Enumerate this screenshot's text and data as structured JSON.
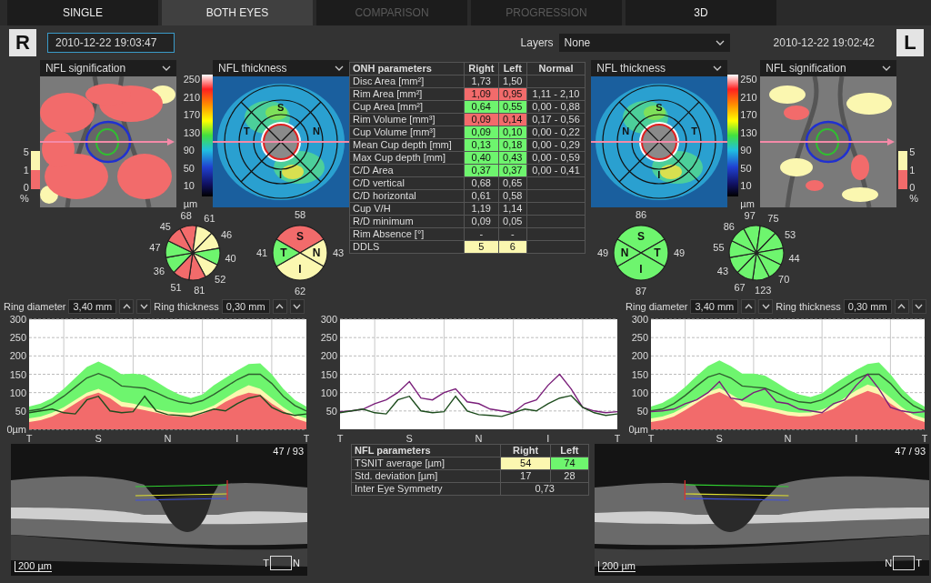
{
  "tabs": [
    {
      "label": "SINGLE",
      "selected": false,
      "disabled": false
    },
    {
      "label": "BOTH EYES",
      "selected": true,
      "disabled": false
    },
    {
      "label": "COMPARISON",
      "selected": false,
      "disabled": true
    },
    {
      "label": "PROGRESSION",
      "selected": false,
      "disabled": true
    },
    {
      "label": "3D",
      "selected": false,
      "disabled": false
    }
  ],
  "header": {
    "right_eye_badge": "R",
    "right_date": "2010-12-22 19:03:47",
    "layers_label": "Layers",
    "layers_value": "None",
    "left_date": "2010-12-22 19:02:42",
    "left_eye_badge": "L"
  },
  "right_eye": {
    "signification": {
      "title": "NFL signification",
      "legend": [
        "5",
        "1",
        "0",
        "%"
      ]
    },
    "thickness": {
      "title": "NFL thickness",
      "scale": [
        "250",
        "210",
        "170",
        "130",
        "90",
        "50",
        "10",
        "µm"
      ],
      "labels": [
        "S",
        "N",
        "I",
        "T"
      ]
    },
    "clock_sectors": [
      {
        "value": "68",
        "color": "#f26b6b"
      },
      {
        "value": "61",
        "color": "#fbf7b0"
      },
      {
        "value": "46",
        "color": "#fbf7b0"
      },
      {
        "value": "40",
        "color": "#6ef56e"
      },
      {
        "value": "52",
        "color": "#fbf7b0"
      },
      {
        "value": "81",
        "color": "#f26b6b"
      },
      {
        "value": "51",
        "color": "#f26b6b"
      },
      {
        "value": "36",
        "color": "#6ef56e"
      },
      {
        "value": "47",
        "color": "#6ef56e"
      },
      {
        "value": "45",
        "color": "#f26b6b"
      }
    ],
    "quadrants": [
      {
        "label": "S",
        "value": "58",
        "color": "#f26b6b"
      },
      {
        "label": "N",
        "value": "43",
        "color": "#fbf7b0"
      },
      {
        "label": "I",
        "value": "62",
        "color": "#fbf7b0"
      },
      {
        "label": "T",
        "value": "41",
        "color": "#6ef56e"
      }
    ],
    "ring": {
      "diameter_label": "Ring diameter",
      "diameter": "3,40 mm",
      "thickness_label": "Ring thickness",
      "thickness": "0,30 mm"
    },
    "tsnit": {
      "chart_data": {
        "type": "area",
        "grid": true,
        "categories": [
          "T",
          null,
          null,
          null,
          null,
          null,
          "S",
          null,
          null,
          null,
          null,
          null,
          "N",
          null,
          null,
          null,
          null,
          null,
          "I",
          null,
          null,
          null,
          null,
          null,
          "T"
        ],
        "ylim": [
          0,
          300
        ],
        "yticks": [
          {
            "value": 0,
            "label": "0µm"
          },
          50,
          100,
          150,
          200,
          250,
          300
        ],
        "series": [
          {
            "color": "#6ef56e",
            "values": [
              62,
              70,
              85,
              110,
              140,
              170,
              185,
              170,
              150,
              152,
              148,
              130,
              110,
              95,
              85,
              95,
              120,
              140,
              160,
              178,
              180,
              150,
              110,
              80,
              62
            ]
          },
          {
            "color": "#fbf7b0",
            "values": [
              30,
              35,
              45,
              60,
              80,
              100,
              110,
              95,
              75,
              70,
              62,
              55,
              48,
              45,
              45,
              52,
              65,
              85,
              105,
              120,
              110,
              85,
              60,
              40,
              30
            ]
          },
          {
            "color": "#f26b6b",
            "values": [
              20,
              25,
              35,
              50,
              70,
              90,
              100,
              85,
              62,
              58,
              52,
              45,
              38,
              35,
              35,
              42,
              55,
              75,
              90,
              100,
              95,
              70,
              50,
              30,
              20
            ]
          },
          {
            "type": "line",
            "color": "#2f5f2f",
            "values": [
              50,
              55,
              70,
              90,
              115,
              140,
              152,
              140,
              118,
              115,
              112,
              100,
              85,
              75,
              70,
              78,
              95,
              115,
              135,
              150,
              150,
              125,
              90,
              65,
              50
            ]
          },
          {
            "type": "line",
            "color": "#1e4d1e",
            "values": [
              45,
              50,
              55,
              45,
              42,
              80,
              90,
              50,
              45,
              48,
              90,
              50,
              40,
              38,
              35,
              45,
              55,
              50,
              70,
              85,
              92,
              60,
              45,
              38,
              42
            ]
          }
        ]
      }
    },
    "bscan": {
      "counter": "47 / 93",
      "scale": "200 µm",
      "orientation": [
        "T",
        "N"
      ]
    }
  },
  "onh_table": {
    "columns": [
      "ONH parameters",
      "Right",
      "Left",
      "Normal"
    ],
    "rows": [
      {
        "label": "Disc Area [mm²]",
        "right": {
          "text": "1,73"
        },
        "left": {
          "text": "1,50"
        }
      },
      {
        "label": "Rim Area [mm²]",
        "right": {
          "text": "1,09",
          "color": "#f26b6b"
        },
        "left": {
          "text": "0,95",
          "color": "#f26b6b"
        },
        "normal": "1,11 - 2,10"
      },
      {
        "label": "Cup Area [mm²]",
        "right": {
          "text": "0,64",
          "color": "#6ef56e"
        },
        "left": {
          "text": "0,55",
          "color": "#6ef56e"
        },
        "normal": "0,00 - 0,88"
      },
      {
        "label": "Rim Volume [mm³]",
        "right": {
          "text": "0,09",
          "color": "#f26b6b"
        },
        "left": {
          "text": "0,14",
          "color": "#f26b6b"
        },
        "normal": "0,17 - 0,56"
      },
      {
        "label": "Cup Volume [mm³]",
        "right": {
          "text": "0,09",
          "color": "#6ef56e"
        },
        "left": {
          "text": "0,10",
          "color": "#6ef56e"
        },
        "normal": "0,00 - 0,22"
      },
      {
        "label": "Mean Cup depth [mm]",
        "right": {
          "text": "0,13",
          "color": "#6ef56e"
        },
        "left": {
          "text": "0,18",
          "color": "#6ef56e"
        },
        "normal": "0,00 - 0,29"
      },
      {
        "label": "Max Cup depth [mm]",
        "right": {
          "text": "0,40",
          "color": "#6ef56e"
        },
        "left": {
          "text": "0,43",
          "color": "#6ef56e"
        },
        "normal": "0,00 - 0,59"
      },
      {
        "label": "C/D Area",
        "right": {
          "text": "0,37",
          "color": "#6ef56e"
        },
        "left": {
          "text": "0,37",
          "color": "#6ef56e"
        },
        "normal": "0,00 - 0,41"
      },
      {
        "label": "C/D vertical",
        "right": {
          "text": "0,68"
        },
        "left": {
          "text": "0,65"
        }
      },
      {
        "label": "C/D horizontal",
        "right": {
          "text": "0,61"
        },
        "left": {
          "text": "0,58"
        }
      },
      {
        "label": "Cup V/H",
        "right": {
          "text": "1,19"
        },
        "left": {
          "text": "1,14"
        }
      },
      {
        "label": "R/D minimum",
        "right": {
          "text": "0,09"
        },
        "left": {
          "text": "0,05"
        }
      },
      {
        "label": "Rim Absence [°]",
        "right": {
          "text": "-"
        },
        "left": {
          "text": "-"
        }
      },
      {
        "label": "DDLS",
        "right": {
          "text": "5",
          "color": "#fbf7b0"
        },
        "left": {
          "text": "6",
          "color": "#fbf7b0"
        }
      }
    ]
  },
  "left_eye": {
    "thickness": {
      "title": "NFL thickness",
      "scale": [
        "250",
        "210",
        "170",
        "130",
        "90",
        "50",
        "10",
        "µm"
      ],
      "labels": [
        "S",
        "T",
        "I",
        "N"
      ]
    },
    "signification": {
      "title": "NFL signification",
      "legend": [
        "5",
        "1",
        "0",
        "%"
      ]
    },
    "quadrants": [
      {
        "label": "S",
        "value": "86",
        "color": "#6ef56e"
      },
      {
        "label": "T",
        "value": "49",
        "color": "#6ef56e"
      },
      {
        "label": "I",
        "value": "87",
        "color": "#6ef56e"
      },
      {
        "label": "N",
        "value": "49",
        "color": "#6ef56e"
      }
    ],
    "clock_sectors": [
      {
        "value": "97",
        "color": "#6ef56e"
      },
      {
        "value": "75",
        "color": "#6ef56e"
      },
      {
        "value": "53",
        "color": "#6ef56e"
      },
      {
        "value": "44",
        "color": "#6ef56e"
      },
      {
        "value": "70",
        "color": "#6ef56e"
      },
      {
        "value": "123",
        "color": "#6ef56e"
      },
      {
        "value": "67",
        "color": "#6ef56e"
      },
      {
        "value": "43",
        "color": "#6ef56e"
      },
      {
        "value": "55",
        "color": "#6ef56e"
      },
      {
        "value": "86",
        "color": "#6ef56e"
      }
    ],
    "ring": {
      "diameter_label": "Ring diameter",
      "diameter": "3,40 mm",
      "thickness_label": "Ring thickness",
      "thickness": "0,30 mm"
    },
    "tsnit": {
      "chart_data": {
        "type": "area",
        "grid": true,
        "categories": [
          "T",
          null,
          null,
          null,
          null,
          null,
          "S",
          null,
          null,
          null,
          null,
          null,
          "N",
          null,
          null,
          null,
          null,
          null,
          "I",
          null,
          null,
          null,
          null,
          null,
          "T"
        ],
        "ylim": [
          0,
          300
        ],
        "yticks": [
          {
            "value": 0,
            "label": "0µm"
          },
          50,
          100,
          150,
          200,
          250,
          300
        ],
        "series": [
          {
            "color": "#6ef56e",
            "values": [
              62,
              72,
              90,
              115,
              145,
              172,
              188,
              172,
              152,
              152,
              146,
              128,
              108,
              95,
              88,
              98,
              122,
              142,
              162,
              178,
              182,
              150,
              110,
              80,
              62
            ]
          },
          {
            "color": "#fbf7b0",
            "values": [
              30,
              35,
              45,
              62,
              82,
              102,
              112,
              96,
              76,
              70,
              62,
              55,
              48,
              45,
              46,
              54,
              66,
              86,
              106,
              122,
              112,
              86,
              60,
              40,
              30
            ]
          },
          {
            "color": "#f26b6b",
            "values": [
              20,
              25,
              35,
              52,
              72,
              92,
              102,
              86,
              62,
              58,
              52,
              45,
              38,
              35,
              36,
              44,
              56,
              76,
              92,
              105,
              95,
              70,
              50,
              30,
              20
            ]
          },
          {
            "type": "line",
            "color": "#2f5f2f",
            "values": [
              50,
              55,
              70,
              92,
              118,
              142,
              152,
              140,
              118,
              115,
              112,
              100,
              85,
              75,
              72,
              80,
              97,
              117,
              137,
              150,
              150,
              125,
              90,
              65,
              50
            ]
          },
          {
            "type": "line",
            "color": "#7a1f7a",
            "values": [
              48,
              50,
              55,
              70,
              80,
              100,
              130,
              85,
              80,
              100,
              110,
              75,
              70,
              55,
              50,
              45,
              70,
              80,
              120,
              150,
              110,
              60,
              50,
              45,
              48
            ]
          }
        ]
      }
    },
    "bscan": {
      "counter": "47 / 93",
      "scale": "200 µm",
      "orientation": [
        "N",
        "T"
      ]
    }
  },
  "comparison": {
    "chart_data": {
      "type": "line",
      "grid": true,
      "categories": [
        "T",
        null,
        null,
        null,
        null,
        null,
        "S",
        null,
        null,
        null,
        null,
        null,
        "N",
        null,
        null,
        null,
        null,
        null,
        "I",
        null,
        null,
        null,
        null,
        null,
        "T"
      ],
      "ylim": [
        0,
        300
      ],
      "yticks": [
        50,
        100,
        150,
        200,
        250,
        300
      ],
      "series": [
        {
          "color": "#7a1f7a",
          "values": [
            48,
            50,
            55,
            70,
            80,
            100,
            130,
            85,
            80,
            100,
            110,
            75,
            70,
            55,
            50,
            45,
            70,
            80,
            120,
            150,
            110,
            60,
            50,
            45,
            48
          ]
        },
        {
          "color": "#1e4d1e",
          "values": [
            45,
            50,
            55,
            45,
            42,
            80,
            90,
            50,
            45,
            48,
            90,
            50,
            40,
            38,
            35,
            45,
            55,
            50,
            70,
            85,
            92,
            60,
            45,
            38,
            42
          ]
        }
      ]
    }
  },
  "nfl_table": {
    "columns": [
      "NFL parameters",
      "Right",
      "Left"
    ],
    "rows": [
      {
        "label": "TSNIT average [µm]",
        "right": {
          "text": "54",
          "color": "#fbf7b0"
        },
        "left": {
          "text": "74",
          "color": "#6ef56e"
        }
      },
      {
        "label": "Std. deviation [µm]",
        "right": {
          "text": "17"
        },
        "left": {
          "text": "28"
        }
      },
      {
        "label": "Inter Eye Symmetry",
        "both": "0,73"
      }
    ]
  }
}
